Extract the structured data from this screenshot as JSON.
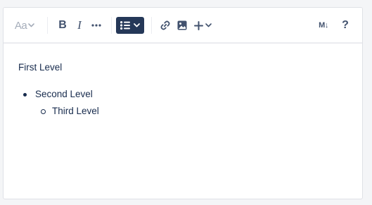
{
  "toolbar": {
    "text_style_label": "Aa",
    "bold_label": "B",
    "italic_label": "I",
    "markdown_label": "M↓",
    "help_label": "?",
    "active_color": "#253858",
    "icon_color": "#42526e",
    "disabled_color": "#a5adba",
    "icons": [
      "chevron-down-icon",
      "more-icon",
      "bullet-list-icon",
      "link-icon",
      "image-icon",
      "plus-icon"
    ]
  },
  "content": {
    "paragraph": "First Level",
    "list": [
      {
        "text": "Second Level",
        "children": [
          {
            "text": "Third Level"
          }
        ]
      }
    ]
  }
}
